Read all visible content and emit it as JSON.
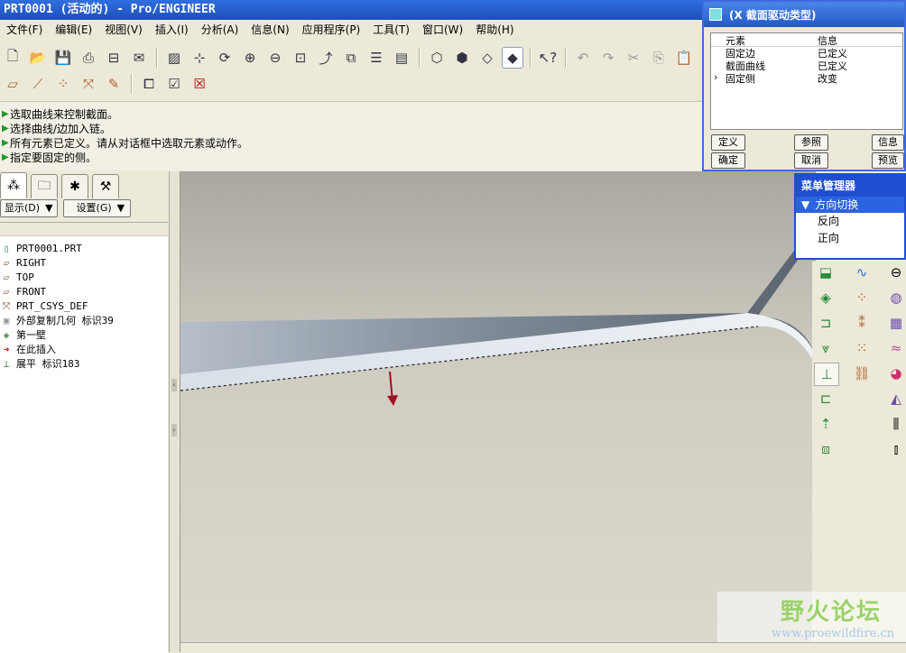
{
  "window": {
    "title": "PRT0001 (活动的) - Pro/ENGINEER"
  },
  "menu": [
    "文件(F)",
    "编辑(E)",
    "视图(V)",
    "插入(I)",
    "分析(A)",
    "信息(N)",
    "应用程序(P)",
    "工具(T)",
    "窗口(W)",
    "帮助(H)"
  ],
  "toolbar1": [
    "new-icon",
    "open-icon",
    "save-icon",
    "print-icon",
    "print-setup-icon",
    "mail-icon",
    "repaint-icon",
    "spin-center-icon",
    "orient-icon",
    "zoom-in-icon",
    "zoom-out-icon",
    "refit-icon",
    "named-view-icon",
    "view-list-icon",
    "layers-icon",
    "appearance-icon",
    "wireframe-icon",
    "hidden-line-icon",
    "no-hidden-icon",
    "shading-icon",
    "context-help-icon",
    "undo-icon",
    "redo-icon",
    "cut-icon",
    "copy-icon",
    "paste-icon"
  ],
  "toolbar2": [
    "datum-plane-icon",
    "datum-axis-icon",
    "datum-point-icon",
    "datum-csys-icon",
    "sketch-icon",
    "window-icon",
    "check-icon",
    "close-window-icon"
  ],
  "messages": [
    "选取曲线来控制截面。",
    "选择曲线/边加入链。",
    "所有元素已定义。请从对话框中选取元素或动作。",
    "指定要固定的侧。"
  ],
  "model_tree": {
    "show_label": "显示(D)",
    "settings_label": "设置(G)",
    "items": [
      {
        "icon": "part-icon",
        "label": "PRT0001.PRT"
      },
      {
        "icon": "datum-plane-icon",
        "label": "RIGHT"
      },
      {
        "icon": "datum-plane-icon",
        "label": "TOP"
      },
      {
        "icon": "datum-plane-icon",
        "label": "FRONT"
      },
      {
        "icon": "csys-icon",
        "label": "PRT_CSYS_DEF"
      },
      {
        "icon": "copy-geom-icon",
        "label": "外部复制几何 标识39"
      },
      {
        "icon": "wall-icon",
        "label": "第一壁"
      },
      {
        "icon": "insert-arrow-icon",
        "label": "在此插入"
      },
      {
        "icon": "flatten-icon",
        "label": "展平 标识183"
      }
    ]
  },
  "dialog": {
    "title": "(X 截面驱动类型)",
    "col_element": "元素",
    "col_info": "信息",
    "rows": [
      {
        "element": "固定边",
        "info": "已定义",
        "current": false
      },
      {
        "element": "截面曲线",
        "info": "已定义",
        "current": false
      },
      {
        "element": "固定侧",
        "info": "改变",
        "current": true
      }
    ],
    "buttons": {
      "define": "定义",
      "refs": "参照",
      "info": "信息",
      "ok": "确定",
      "cancel": "取消",
      "preview": "预览"
    }
  },
  "menu_manager": {
    "title": "菜单管理器",
    "section": "方向切换",
    "items": [
      "反向",
      "正向"
    ]
  },
  "watermark": {
    "text": "野火论坛",
    "url": "www.proewildfire.cn"
  }
}
